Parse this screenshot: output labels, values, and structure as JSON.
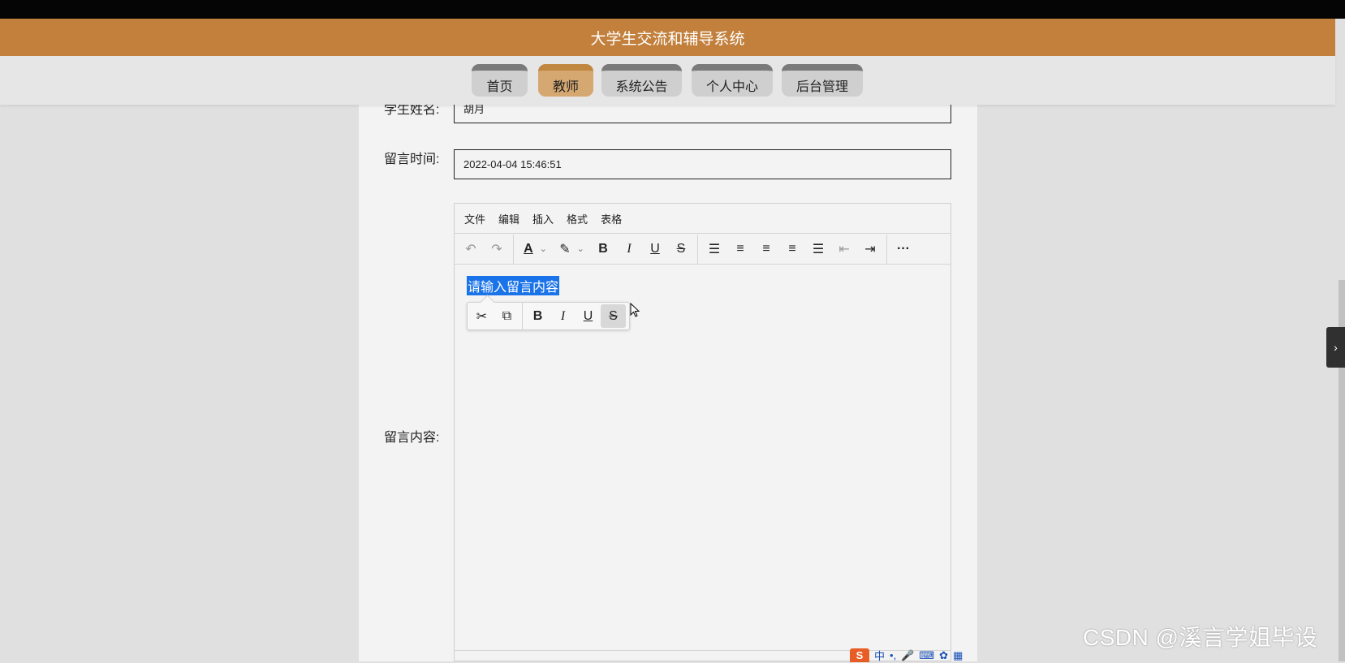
{
  "app": {
    "title": "大学生交流和辅导系统"
  },
  "nav": {
    "items": [
      {
        "label": "首页"
      },
      {
        "label": "教师"
      },
      {
        "label": "系统公告"
      },
      {
        "label": "个人中心"
      },
      {
        "label": "后台管理"
      }
    ],
    "active": "教师"
  },
  "form": {
    "student_name": {
      "label": "学生姓名:",
      "value": "胡月"
    },
    "message_time": {
      "label": "留言时间:",
      "value": "2022-04-04 15:46:51"
    },
    "message_content": {
      "label": "留言内容:",
      "placeholder": "请输入留言内容"
    }
  },
  "editor": {
    "menu": [
      "文件",
      "编辑",
      "插入",
      "格式",
      "表格"
    ],
    "toolbar_icons": [
      "undo-icon",
      "redo-icon",
      "text-color-icon",
      "highlight-icon",
      "bold-icon",
      "italic-icon",
      "underline-icon",
      "strikethrough-icon",
      "line-height-icon",
      "align-left-icon",
      "align-center-icon",
      "align-right-icon",
      "align-justify-icon",
      "outdent-icon",
      "indent-icon",
      "more-icon"
    ],
    "quickbar_icons": [
      "cut-icon",
      "copy-icon",
      "bold-icon",
      "italic-icon",
      "underline-icon",
      "strikethrough-icon"
    ],
    "quickbar_active": "strikethrough-icon"
  },
  "watermark": {
    "text": "CSDN @溪言学姐毕设"
  },
  "ime": {
    "lang": "中"
  },
  "colors": {
    "header": "#c2803c",
    "nav_active": "#d5a872",
    "selection": "#1a73e8"
  }
}
